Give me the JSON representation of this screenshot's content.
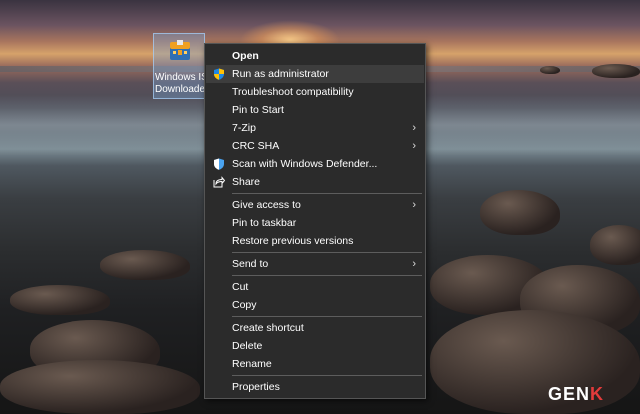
{
  "desktop": {
    "icon_label_line1": "Windows IS",
    "icon_label_line2": "Downloade",
    "icon_name": "windows-iso-downloader-icon"
  },
  "context_menu": {
    "items": [
      {
        "label": "Open",
        "bold": true
      },
      {
        "label": "Run as administrator",
        "icon": "shield-icon",
        "highlighted": true
      },
      {
        "label": "Troubleshoot compatibility"
      },
      {
        "label": "Pin to Start"
      },
      {
        "label": "7-Zip",
        "submenu": true
      },
      {
        "label": "CRC SHA",
        "submenu": true
      },
      {
        "label": "Scan with Windows Defender...",
        "icon": "defender-icon"
      },
      {
        "label": "Share",
        "icon": "share-icon"
      },
      {
        "label": "Give access to",
        "submenu": true
      },
      {
        "label": "Pin to taskbar"
      },
      {
        "label": "Restore previous versions"
      },
      {
        "label": "Send to",
        "submenu": true
      },
      {
        "label": "Cut"
      },
      {
        "label": "Copy"
      },
      {
        "label": "Create shortcut"
      },
      {
        "label": "Delete"
      },
      {
        "label": "Rename"
      },
      {
        "label": "Properties"
      }
    ],
    "submenu_arrow": "›"
  },
  "watermark": {
    "text_main": "GEN",
    "text_accent": "K"
  },
  "colors": {
    "menu_bg": "#2b2b2b",
    "highlight": "#3d3d3d",
    "separator": "#5d5d5d",
    "accent_red": "#e23b3b"
  }
}
